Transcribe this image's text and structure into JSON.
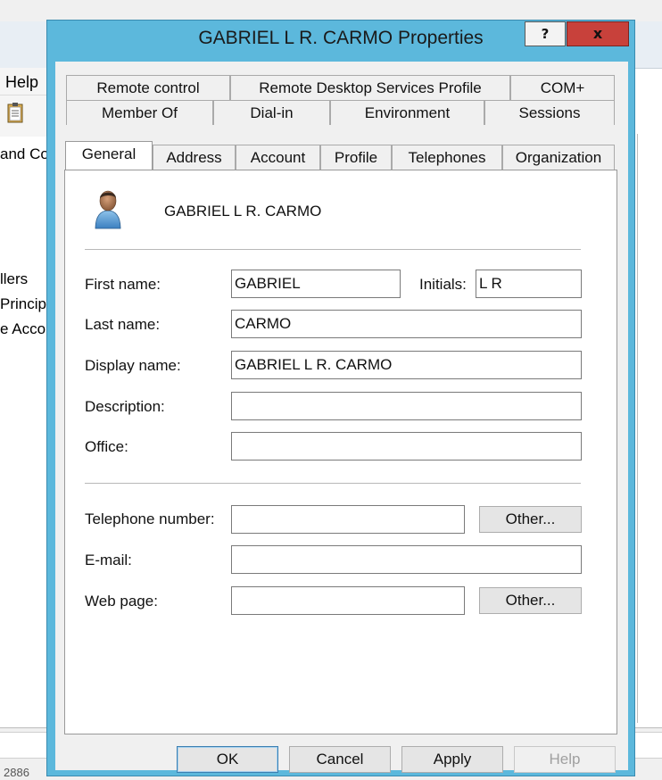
{
  "background": {
    "menu_help": "Help",
    "tree_items": [
      "and Co",
      "llers",
      "Princip",
      "e Acco"
    ],
    "bottom_text": "2886"
  },
  "dialog": {
    "title": "GABRIEL L R. CARMO Properties",
    "help_glyph": "?",
    "close_glyph": "x",
    "tabs_row1": [
      "Remote control",
      "Remote Desktop Services Profile",
      "COM+"
    ],
    "tabs_row2": [
      "Member Of",
      "Dial-in",
      "Environment",
      "Sessions"
    ],
    "tabs_row3": [
      "General",
      "Address",
      "Account",
      "Profile",
      "Telephones",
      "Organization"
    ],
    "active_tab": "General",
    "general": {
      "display_header": "GABRIEL L R. CARMO",
      "first_name_label": "First name:",
      "first_name_value": "GABRIEL",
      "initials_label": "Initials:",
      "initials_value": "L R",
      "last_name_label": "Last name:",
      "last_name_value": "CARMO",
      "display_name_label": "Display name:",
      "display_name_value": "GABRIEL L R. CARMO",
      "description_label": "Description:",
      "description_value": "",
      "office_label": "Office:",
      "office_value": "",
      "telephone_label": "Telephone number:",
      "telephone_value": "",
      "telephone_other_label": "Other...",
      "email_label": "E-mail:",
      "email_value": "",
      "webpage_label": "Web page:",
      "webpage_value": "",
      "webpage_other_label": "Other..."
    },
    "buttons": {
      "ok": "OK",
      "cancel": "Cancel",
      "apply": "Apply",
      "help": "Help"
    }
  },
  "icons": {
    "user_icon": "user-icon",
    "clipboard_icon": "clipboard-icon"
  },
  "colors": {
    "dialog_frame": "#5cb8dc",
    "close_button": "#c8413b",
    "ok_border": "#3c7fb1"
  }
}
